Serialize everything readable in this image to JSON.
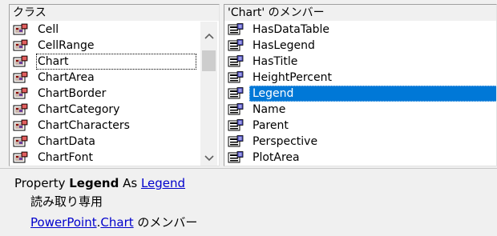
{
  "classes_pane": {
    "header": "クラス",
    "items": [
      {
        "label": "Cell"
      },
      {
        "label": "CellRange"
      },
      {
        "label": "Chart"
      },
      {
        "label": "ChartArea"
      },
      {
        "label": "ChartBorder"
      },
      {
        "label": "ChartCategory"
      },
      {
        "label": "ChartCharacters"
      },
      {
        "label": "ChartData"
      },
      {
        "label": "ChartFont"
      }
    ],
    "focused_item": "Chart",
    "scrollbar": {
      "up_icon": "chevron-up-icon",
      "down_icon": "chevron-down-icon"
    }
  },
  "members_pane": {
    "header": "'Chart' のメンバー",
    "items": [
      {
        "label": "HasDataTable"
      },
      {
        "label": "HasLegend"
      },
      {
        "label": "HasTitle"
      },
      {
        "label": "HeightPercent"
      },
      {
        "label": "Legend"
      },
      {
        "label": "Name"
      },
      {
        "label": "Parent"
      },
      {
        "label": "Perspective"
      },
      {
        "label": "PlotArea"
      }
    ],
    "selected_item": "Legend",
    "selection_color": "#0078d7"
  },
  "detail": {
    "prefix": "Property ",
    "member_name": "Legend",
    "as_text": " As ",
    "type_link": "Legend",
    "readonly_text": "読み取り専用",
    "library_link": "PowerPoint",
    "dot": ".",
    "class_link": "Chart",
    "member_of_text": " のメンバー",
    "link_color": "#0000cc"
  }
}
